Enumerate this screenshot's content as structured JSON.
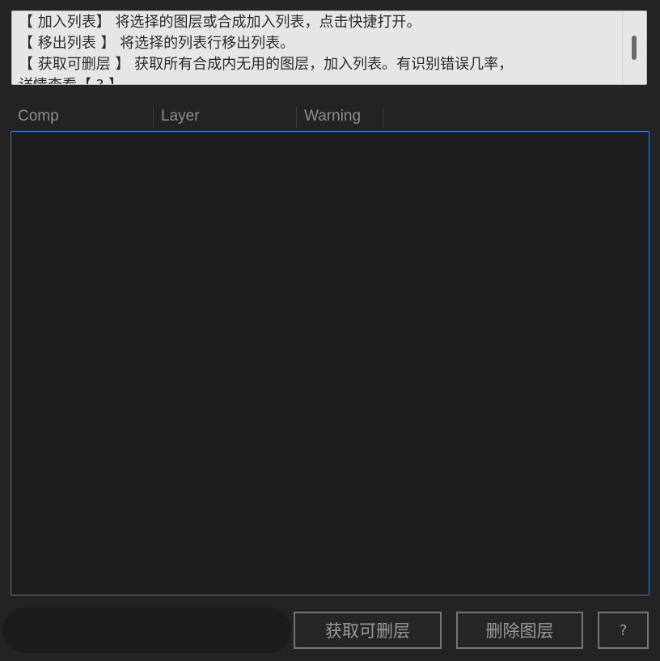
{
  "info": {
    "lines": [
      "【 加入列表】 将选择的图层或合成加入列表，点击快捷打开。",
      "【 移出列表 】 将选择的列表行移出列表。",
      "【 获取可删层 】 获取所有合成内无用的图层，加入列表。有识别错误几率，",
      "详情查看【 ? 】"
    ]
  },
  "table": {
    "columns": [
      "Comp",
      "Layer",
      "Warning"
    ],
    "rows": []
  },
  "footer": {
    "input_value": "",
    "get_deletable_label": "获取可删层",
    "delete_layers_label": "删除图层",
    "help_label": "?"
  },
  "colors": {
    "background": "#232323",
    "list_border": "#2f7fd6",
    "info_background": "#e6e6e6"
  }
}
